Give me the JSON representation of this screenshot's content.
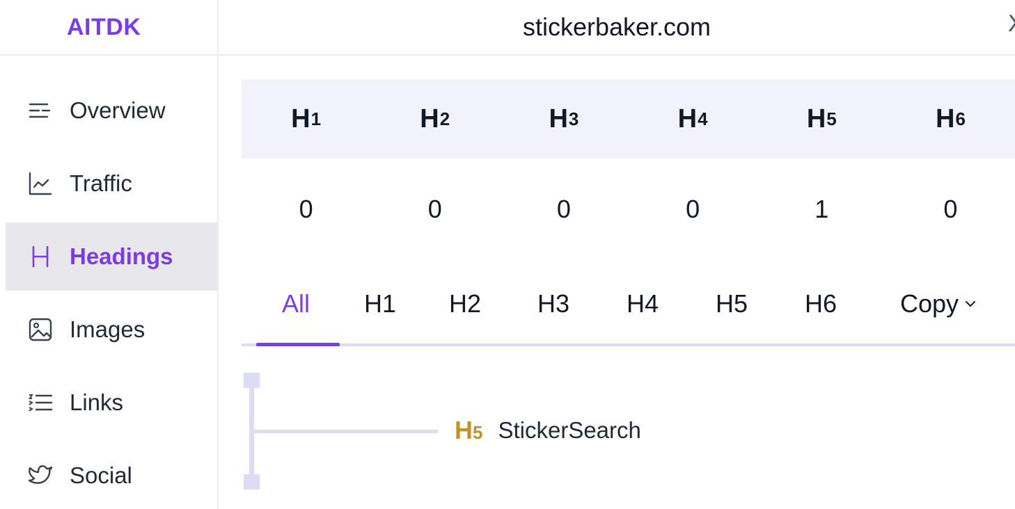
{
  "brand": "AITDK",
  "header": {
    "domain": "stickerbaker.com",
    "close_glyph": "X"
  },
  "sidebar": {
    "items": [
      {
        "label": "Overview",
        "icon": "overview-icon",
        "active": false
      },
      {
        "label": "Traffic",
        "icon": "traffic-chart-icon",
        "active": false
      },
      {
        "label": "Headings",
        "icon": "heading-h-icon",
        "active": true
      },
      {
        "label": "Images",
        "icon": "image-icon",
        "active": false
      },
      {
        "label": "Links",
        "icon": "links-list-icon",
        "active": false
      },
      {
        "label": "Social",
        "icon": "twitter-bird-icon",
        "active": false
      }
    ]
  },
  "heading_stats": {
    "columns": [
      {
        "tag": "H",
        "level": "1",
        "count": "0"
      },
      {
        "tag": "H",
        "level": "2",
        "count": "0"
      },
      {
        "tag": "H",
        "level": "3",
        "count": "0"
      },
      {
        "tag": "H",
        "level": "4",
        "count": "0"
      },
      {
        "tag": "H",
        "level": "5",
        "count": "1"
      },
      {
        "tag": "H",
        "level": "6",
        "count": "0"
      }
    ]
  },
  "tabs": {
    "items": [
      "All",
      "H1",
      "H2",
      "H3",
      "H4",
      "H5",
      "H6"
    ],
    "active": "All",
    "copy_label": "Copy"
  },
  "tree": {
    "entries": [
      {
        "tag": "H",
        "level": "5",
        "text": "StickerSearch"
      }
    ]
  },
  "colors": {
    "accent": "#7c3aed",
    "h5_level": "#c29227",
    "track": "#dcdcf5",
    "stats_bg": "#f2f2fb",
    "active_nav_bg": "#e8e8ec"
  }
}
